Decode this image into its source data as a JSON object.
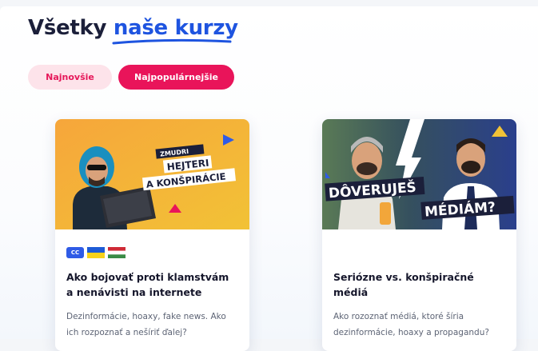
{
  "header": {
    "title_part1": "Všetky",
    "title_part2": "naše kurzy"
  },
  "filters": {
    "newest": "Najnovšie",
    "popular": "Najpopulárnejšie"
  },
  "courses": [
    {
      "thumb_brand": "ZMUDRI",
      "thumb_line1": "HEJTERI",
      "thumb_line2": "A KONŠPIRÁCIE",
      "badge_cc": "CC",
      "title": "Ako bojovať proti klamstvám a nenávisti na internete",
      "description": "Dezinformácie, hoaxy, fake news. Ako ich rozpoznať a nešíriť ďalej?"
    },
    {
      "thumb_line1": "DÔVERUJEŠ",
      "thumb_line2": "MÉDIÁM?",
      "title": "Seriózne vs. konšpiračné médiá",
      "description": "Ako rozoznať médiá, ktoré šíria dezinformácie, hoaxy a propagandu?"
    }
  ],
  "colors": {
    "brand_blue": "#1e54e0",
    "brand_pink": "#e9145a",
    "pink_light": "#fde3ea",
    "title_dark": "#1b1f3a"
  }
}
